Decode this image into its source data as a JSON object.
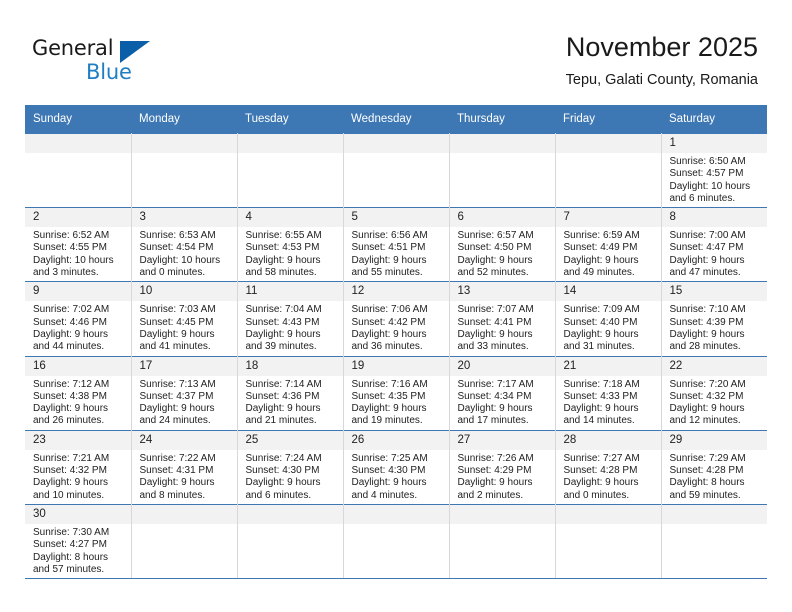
{
  "brand": {
    "name_part1": "General",
    "name_part2": "Blue",
    "triangle_icon": "triangle-icon",
    "accent_color": "#1f7ec4",
    "logo_dark_color": "#1a1a1a"
  },
  "header": {
    "title": "November 2025",
    "subtitle": "Tepu, Galati County, Romania"
  },
  "calendar": {
    "header_bg_color": "#3d77b4",
    "daynum_bg_color": "#f2f2f2",
    "weekdays": [
      "Sunday",
      "Monday",
      "Tuesday",
      "Wednesday",
      "Thursday",
      "Friday",
      "Saturday"
    ],
    "weeks": [
      [
        {
          "day": "",
          "l1": "",
          "l2": "",
          "l3": "",
          "l4": "",
          "empty": true
        },
        {
          "day": "",
          "l1": "",
          "l2": "",
          "l3": "",
          "l4": "",
          "empty": true
        },
        {
          "day": "",
          "l1": "",
          "l2": "",
          "l3": "",
          "l4": "",
          "empty": true
        },
        {
          "day": "",
          "l1": "",
          "l2": "",
          "l3": "",
          "l4": "",
          "empty": true
        },
        {
          "day": "",
          "l1": "",
          "l2": "",
          "l3": "",
          "l4": "",
          "empty": true
        },
        {
          "day": "",
          "l1": "",
          "l2": "",
          "l3": "",
          "l4": "",
          "empty": true
        },
        {
          "day": "1",
          "l1": "Sunrise: 6:50 AM",
          "l2": "Sunset: 4:57 PM",
          "l3": "Daylight: 10 hours",
          "l4": "and 6 minutes."
        }
      ],
      [
        {
          "day": "2",
          "l1": "Sunrise: 6:52 AM",
          "l2": "Sunset: 4:55 PM",
          "l3": "Daylight: 10 hours",
          "l4": "and 3 minutes."
        },
        {
          "day": "3",
          "l1": "Sunrise: 6:53 AM",
          "l2": "Sunset: 4:54 PM",
          "l3": "Daylight: 10 hours",
          "l4": "and 0 minutes."
        },
        {
          "day": "4",
          "l1": "Sunrise: 6:55 AM",
          "l2": "Sunset: 4:53 PM",
          "l3": "Daylight: 9 hours",
          "l4": "and 58 minutes."
        },
        {
          "day": "5",
          "l1": "Sunrise: 6:56 AM",
          "l2": "Sunset: 4:51 PM",
          "l3": "Daylight: 9 hours",
          "l4": "and 55 minutes."
        },
        {
          "day": "6",
          "l1": "Sunrise: 6:57 AM",
          "l2": "Sunset: 4:50 PM",
          "l3": "Daylight: 9 hours",
          "l4": "and 52 minutes."
        },
        {
          "day": "7",
          "l1": "Sunrise: 6:59 AM",
          "l2": "Sunset: 4:49 PM",
          "l3": "Daylight: 9 hours",
          "l4": "and 49 minutes."
        },
        {
          "day": "8",
          "l1": "Sunrise: 7:00 AM",
          "l2": "Sunset: 4:47 PM",
          "l3": "Daylight: 9 hours",
          "l4": "and 47 minutes."
        }
      ],
      [
        {
          "day": "9",
          "l1": "Sunrise: 7:02 AM",
          "l2": "Sunset: 4:46 PM",
          "l3": "Daylight: 9 hours",
          "l4": "and 44 minutes."
        },
        {
          "day": "10",
          "l1": "Sunrise: 7:03 AM",
          "l2": "Sunset: 4:45 PM",
          "l3": "Daylight: 9 hours",
          "l4": "and 41 minutes."
        },
        {
          "day": "11",
          "l1": "Sunrise: 7:04 AM",
          "l2": "Sunset: 4:43 PM",
          "l3": "Daylight: 9 hours",
          "l4": "and 39 minutes."
        },
        {
          "day": "12",
          "l1": "Sunrise: 7:06 AM",
          "l2": "Sunset: 4:42 PM",
          "l3": "Daylight: 9 hours",
          "l4": "and 36 minutes."
        },
        {
          "day": "13",
          "l1": "Sunrise: 7:07 AM",
          "l2": "Sunset: 4:41 PM",
          "l3": "Daylight: 9 hours",
          "l4": "and 33 minutes."
        },
        {
          "day": "14",
          "l1": "Sunrise: 7:09 AM",
          "l2": "Sunset: 4:40 PM",
          "l3": "Daylight: 9 hours",
          "l4": "and 31 minutes."
        },
        {
          "day": "15",
          "l1": "Sunrise: 7:10 AM",
          "l2": "Sunset: 4:39 PM",
          "l3": "Daylight: 9 hours",
          "l4": "and 28 minutes."
        }
      ],
      [
        {
          "day": "16",
          "l1": "Sunrise: 7:12 AM",
          "l2": "Sunset: 4:38 PM",
          "l3": "Daylight: 9 hours",
          "l4": "and 26 minutes."
        },
        {
          "day": "17",
          "l1": "Sunrise: 7:13 AM",
          "l2": "Sunset: 4:37 PM",
          "l3": "Daylight: 9 hours",
          "l4": "and 24 minutes."
        },
        {
          "day": "18",
          "l1": "Sunrise: 7:14 AM",
          "l2": "Sunset: 4:36 PM",
          "l3": "Daylight: 9 hours",
          "l4": "and 21 minutes."
        },
        {
          "day": "19",
          "l1": "Sunrise: 7:16 AM",
          "l2": "Sunset: 4:35 PM",
          "l3": "Daylight: 9 hours",
          "l4": "and 19 minutes."
        },
        {
          "day": "20",
          "l1": "Sunrise: 7:17 AM",
          "l2": "Sunset: 4:34 PM",
          "l3": "Daylight: 9 hours",
          "l4": "and 17 minutes."
        },
        {
          "day": "21",
          "l1": "Sunrise: 7:18 AM",
          "l2": "Sunset: 4:33 PM",
          "l3": "Daylight: 9 hours",
          "l4": "and 14 minutes."
        },
        {
          "day": "22",
          "l1": "Sunrise: 7:20 AM",
          "l2": "Sunset: 4:32 PM",
          "l3": "Daylight: 9 hours",
          "l4": "and 12 minutes."
        }
      ],
      [
        {
          "day": "23",
          "l1": "Sunrise: 7:21 AM",
          "l2": "Sunset: 4:32 PM",
          "l3": "Daylight: 9 hours",
          "l4": "and 10 minutes."
        },
        {
          "day": "24",
          "l1": "Sunrise: 7:22 AM",
          "l2": "Sunset: 4:31 PM",
          "l3": "Daylight: 9 hours",
          "l4": "and 8 minutes."
        },
        {
          "day": "25",
          "l1": "Sunrise: 7:24 AM",
          "l2": "Sunset: 4:30 PM",
          "l3": "Daylight: 9 hours",
          "l4": "and 6 minutes."
        },
        {
          "day": "26",
          "l1": "Sunrise: 7:25 AM",
          "l2": "Sunset: 4:30 PM",
          "l3": "Daylight: 9 hours",
          "l4": "and 4 minutes."
        },
        {
          "day": "27",
          "l1": "Sunrise: 7:26 AM",
          "l2": "Sunset: 4:29 PM",
          "l3": "Daylight: 9 hours",
          "l4": "and 2 minutes."
        },
        {
          "day": "28",
          "l1": "Sunrise: 7:27 AM",
          "l2": "Sunset: 4:28 PM",
          "l3": "Daylight: 9 hours",
          "l4": "and 0 minutes."
        },
        {
          "day": "29",
          "l1": "Sunrise: 7:29 AM",
          "l2": "Sunset: 4:28 PM",
          "l3": "Daylight: 8 hours",
          "l4": "and 59 minutes."
        }
      ],
      [
        {
          "day": "30",
          "l1": "Sunrise: 7:30 AM",
          "l2": "Sunset: 4:27 PM",
          "l3": "Daylight: 8 hours",
          "l4": "and 57 minutes."
        },
        {
          "day": "",
          "l1": "",
          "l2": "",
          "l3": "",
          "l4": "",
          "empty": true
        },
        {
          "day": "",
          "l1": "",
          "l2": "",
          "l3": "",
          "l4": "",
          "empty": true
        },
        {
          "day": "",
          "l1": "",
          "l2": "",
          "l3": "",
          "l4": "",
          "empty": true
        },
        {
          "day": "",
          "l1": "",
          "l2": "",
          "l3": "",
          "l4": "",
          "empty": true
        },
        {
          "day": "",
          "l1": "",
          "l2": "",
          "l3": "",
          "l4": "",
          "empty": true
        },
        {
          "day": "",
          "l1": "",
          "l2": "",
          "l3": "",
          "l4": "",
          "empty": true
        }
      ]
    ]
  }
}
